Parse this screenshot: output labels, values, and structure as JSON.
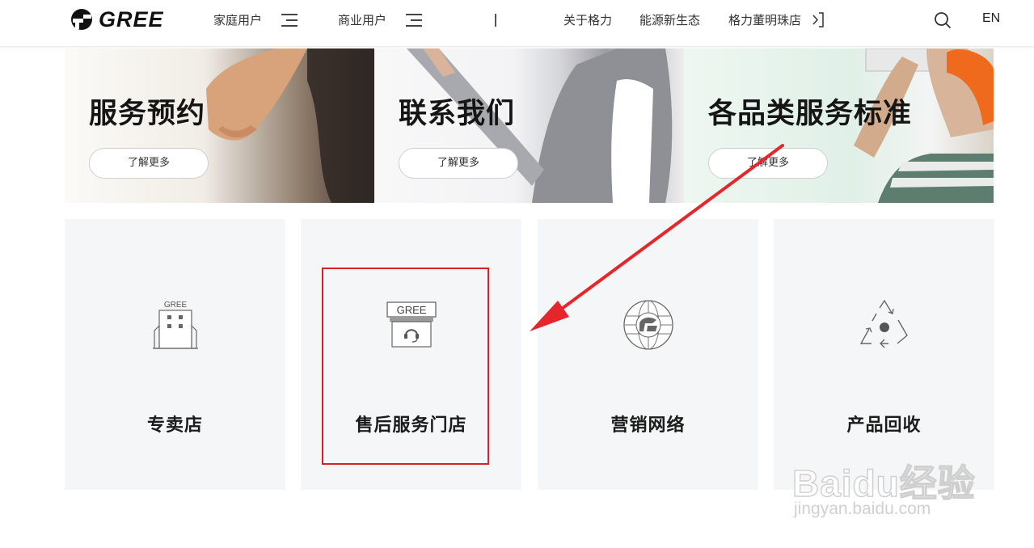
{
  "header": {
    "logo_text": "GREE",
    "nav_home": "家庭用户",
    "nav_business": "商业用户",
    "nav_about": "关于格力",
    "nav_energy": "能源新生态",
    "nav_store": "格力董明珠店",
    "lang": "EN"
  },
  "banners": [
    {
      "title": "服务预约",
      "button": "了解更多"
    },
    {
      "title": "联系我们",
      "button": "了解更多"
    },
    {
      "title": "各品类服务标准",
      "button": "了解更多"
    }
  ],
  "cards": [
    {
      "label": "专卖店",
      "icon": "store-building-icon",
      "icon_text": "GREE"
    },
    {
      "label": "售后服务门店",
      "icon": "service-store-icon",
      "icon_text": "GREE"
    },
    {
      "label": "营销网络",
      "icon": "globe-network-icon"
    },
    {
      "label": "产品回收",
      "icon": "recycle-icon"
    }
  ],
  "annotation": {
    "highlight_color": "#d8202a",
    "arrow_color": "#e5262b"
  },
  "watermark": {
    "brand": "Baidu经验",
    "url": "jingyan.baidu.com"
  }
}
